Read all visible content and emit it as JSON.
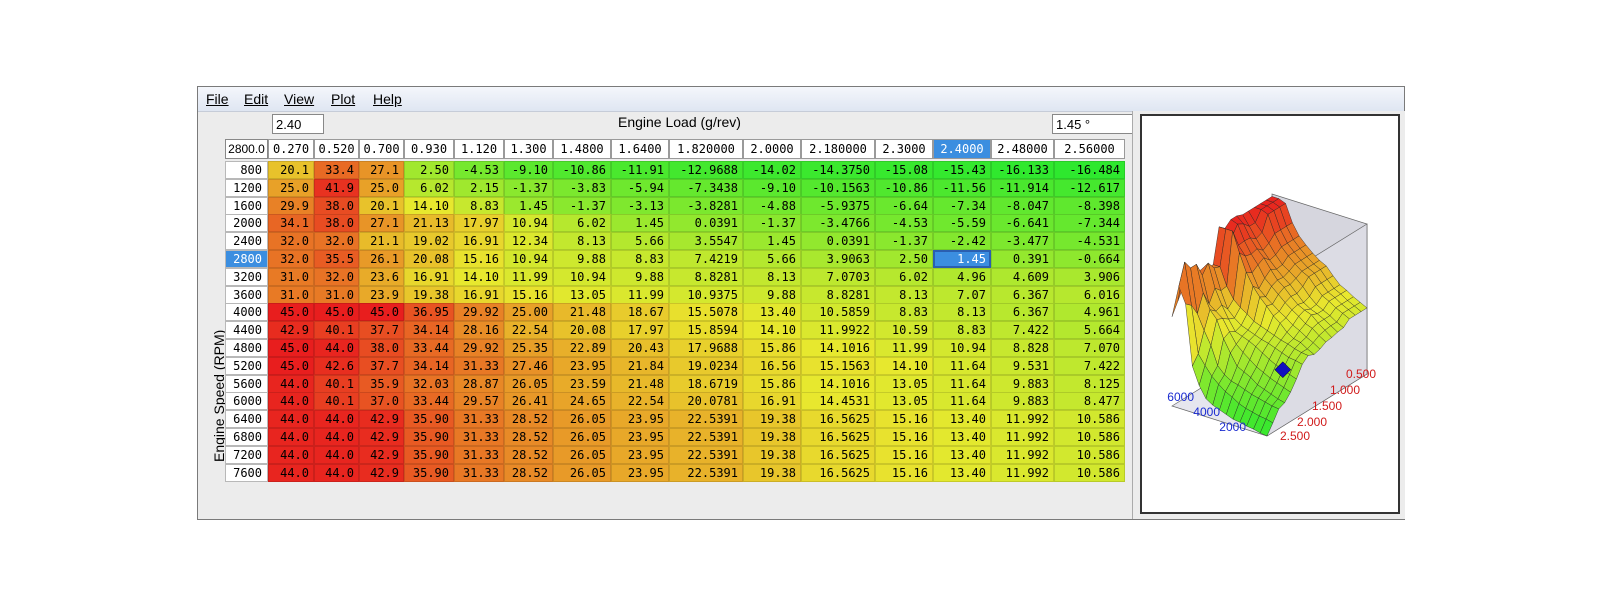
{
  "menu": [
    {
      "label": "File",
      "accel_index": 0
    },
    {
      "label": "Edit",
      "accel_index": 0
    },
    {
      "label": "View",
      "accel_index": 0
    },
    {
      "label": "Plot",
      "accel_index": 0
    },
    {
      "label": "Help",
      "accel_index": 0
    }
  ],
  "toolbar": {
    "load_value": "2.40",
    "x_axis_title": "Engine Load (g/rev)",
    "angle_value": "1.45 °"
  },
  "y_axis_title": "Engine Speed (RPM)",
  "corner_value": "2800.0",
  "selection": {
    "row": 5,
    "col": 12
  },
  "columns": [
    "0.270",
    "0.520",
    "0.700",
    "0.930",
    "1.120",
    "1.300",
    "1.4800",
    "1.6400",
    "1.820000",
    "2.0000",
    "2.180000",
    "2.3000",
    "2.4000",
    "2.48000",
    "2.56000"
  ],
  "rows": [
    {
      "rpm": "800",
      "values": [
        "20.1",
        "33.4",
        "27.1",
        "2.50",
        "-4.53",
        "-9.10",
        "-10.86",
        "-11.91",
        "-12.9688",
        "-14.02",
        "-14.3750",
        "-15.08",
        "-15.43",
        "-16.133",
        "-16.484"
      ]
    },
    {
      "rpm": "1200",
      "values": [
        "25.0",
        "41.9",
        "25.0",
        "6.02",
        "2.15",
        "-1.37",
        "-3.83",
        "-5.94",
        "-7.3438",
        "-9.10",
        "-10.1563",
        "-10.86",
        "-11.56",
        "-11.914",
        "-12.617"
      ]
    },
    {
      "rpm": "1600",
      "values": [
        "29.9",
        "38.0",
        "20.1",
        "14.10",
        "8.83",
        "1.45",
        "-1.37",
        "-3.13",
        "-3.8281",
        "-4.88",
        "-5.9375",
        "-6.64",
        "-7.34",
        "-8.047",
        "-8.398"
      ]
    },
    {
      "rpm": "2000",
      "values": [
        "34.1",
        "38.0",
        "27.1",
        "21.13",
        "17.97",
        "10.94",
        "6.02",
        "1.45",
        "0.0391",
        "-1.37",
        "-3.4766",
        "-4.53",
        "-5.59",
        "-6.641",
        "-7.344"
      ]
    },
    {
      "rpm": "2400",
      "values": [
        "32.0",
        "32.0",
        "21.1",
        "19.02",
        "16.91",
        "12.34",
        "8.13",
        "5.66",
        "3.5547",
        "1.45",
        "0.0391",
        "-1.37",
        "-2.42",
        "-3.477",
        "-4.531"
      ]
    },
    {
      "rpm": "2800",
      "values": [
        "32.0",
        "35.5",
        "26.1",
        "20.08",
        "15.16",
        "10.94",
        "9.88",
        "8.83",
        "7.4219",
        "5.66",
        "3.9063",
        "2.50",
        "1.45",
        "0.391",
        "-0.664"
      ]
    },
    {
      "rpm": "3200",
      "values": [
        "31.0",
        "32.0",
        "23.6",
        "16.91",
        "14.10",
        "11.99",
        "10.94",
        "9.88",
        "8.8281",
        "8.13",
        "7.0703",
        "6.02",
        "4.96",
        "4.609",
        "3.906"
      ]
    },
    {
      "rpm": "3600",
      "values": [
        "31.0",
        "31.0",
        "23.9",
        "19.38",
        "16.91",
        "15.16",
        "13.05",
        "11.99",
        "10.9375",
        "9.88",
        "8.8281",
        "8.13",
        "7.07",
        "6.367",
        "6.016"
      ]
    },
    {
      "rpm": "4000",
      "values": [
        "45.0",
        "45.0",
        "45.0",
        "36.95",
        "29.92",
        "25.00",
        "21.48",
        "18.67",
        "15.5078",
        "13.40",
        "10.5859",
        "8.83",
        "8.13",
        "6.367",
        "4.961"
      ]
    },
    {
      "rpm": "4400",
      "values": [
        "42.9",
        "40.1",
        "37.7",
        "34.14",
        "28.16",
        "22.54",
        "20.08",
        "17.97",
        "15.8594",
        "14.10",
        "11.9922",
        "10.59",
        "8.83",
        "7.422",
        "5.664"
      ]
    },
    {
      "rpm": "4800",
      "values": [
        "45.0",
        "44.0",
        "38.0",
        "33.44",
        "29.92",
        "25.35",
        "22.89",
        "20.43",
        "17.9688",
        "15.86",
        "14.1016",
        "11.99",
        "10.94",
        "8.828",
        "7.070"
      ]
    },
    {
      "rpm": "5200",
      "values": [
        "45.0",
        "42.6",
        "37.7",
        "34.14",
        "31.33",
        "27.46",
        "23.95",
        "21.84",
        "19.0234",
        "16.56",
        "15.1563",
        "14.10",
        "11.64",
        "9.531",
        "7.422"
      ]
    },
    {
      "rpm": "5600",
      "values": [
        "44.0",
        "40.1",
        "35.9",
        "32.03",
        "28.87",
        "26.05",
        "23.59",
        "21.48",
        "18.6719",
        "15.86",
        "14.1016",
        "13.05",
        "11.64",
        "9.883",
        "8.125"
      ]
    },
    {
      "rpm": "6000",
      "values": [
        "44.0",
        "40.1",
        "37.0",
        "33.44",
        "29.57",
        "26.41",
        "24.65",
        "22.54",
        "20.0781",
        "16.91",
        "14.4531",
        "13.05",
        "11.64",
        "9.883",
        "8.477"
      ]
    },
    {
      "rpm": "6400",
      "values": [
        "44.0",
        "44.0",
        "42.9",
        "35.90",
        "31.33",
        "28.52",
        "26.05",
        "23.95",
        "22.5391",
        "19.38",
        "16.5625",
        "15.16",
        "13.40",
        "11.992",
        "10.586"
      ]
    },
    {
      "rpm": "6800",
      "values": [
        "44.0",
        "44.0",
        "42.9",
        "35.90",
        "31.33",
        "28.52",
        "26.05",
        "23.95",
        "22.5391",
        "19.38",
        "16.5625",
        "15.16",
        "13.40",
        "11.992",
        "10.586"
      ]
    },
    {
      "rpm": "7200",
      "values": [
        "44.0",
        "44.0",
        "42.9",
        "35.90",
        "31.33",
        "28.52",
        "26.05",
        "23.95",
        "22.5391",
        "19.38",
        "16.5625",
        "15.16",
        "13.40",
        "11.992",
        "10.586"
      ]
    },
    {
      "rpm": "7600",
      "values": [
        "44.0",
        "44.0",
        "42.9",
        "35.90",
        "31.33",
        "28.52",
        "26.05",
        "23.95",
        "22.5391",
        "19.38",
        "16.5625",
        "15.16",
        "13.40",
        "11.992",
        "10.586"
      ]
    }
  ],
  "color_scale": {
    "min": -16.5,
    "max": 45.0,
    "low_color": "#2ee82e",
    "mid_color": "#e8e82e",
    "high_color": "#e81e1e"
  },
  "plot3d": {
    "rpm_tick_color": "#1a2bd0",
    "load_tick_color": "#d01a1a",
    "rpm_ticks": [
      "6000",
      "4000",
      "2000"
    ],
    "load_ticks": [
      "0.500",
      "1.000",
      "1.500",
      "2.000",
      "2.500"
    ],
    "cursor_color": "#1010c0"
  }
}
